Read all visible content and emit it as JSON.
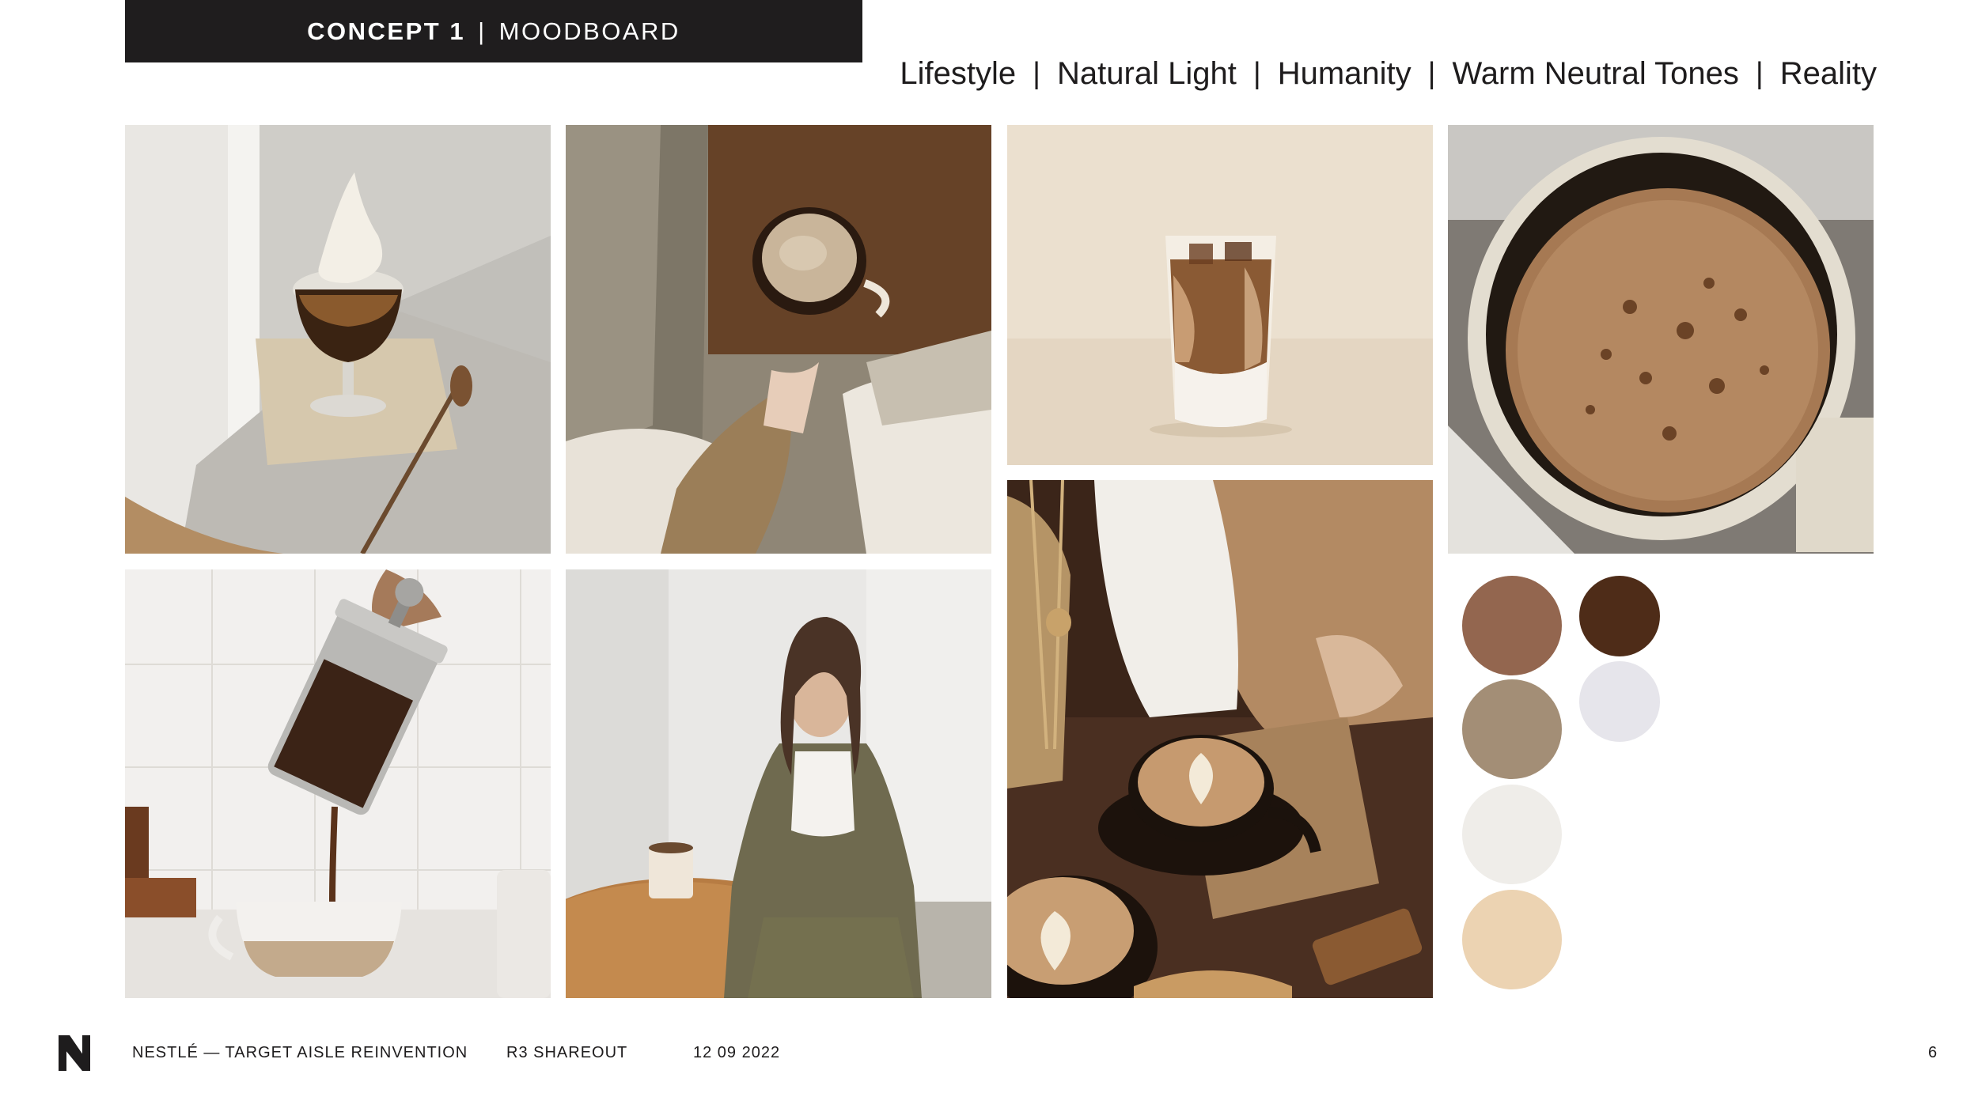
{
  "header": {
    "concept_label": "CONCEPT 1",
    "separator": "|",
    "board_label": "MOODBOARD"
  },
  "keywords": [
    "Lifestyle",
    "Natural Light",
    "Humanity",
    "Warm Neutral Tones",
    "Reality"
  ],
  "keyword_separator": "|",
  "images": [
    {
      "name": "affogato-dessert-image",
      "subject": "affogato in glass with spoon on napkin"
    },
    {
      "name": "coffee-mug-in-hand-image",
      "subject": "hand holding coffee mug on wooden table, knit sweater"
    },
    {
      "name": "iced-latte-image",
      "subject": "iced latte in glass on beige background"
    },
    {
      "name": "frothy-coffee-cup-image",
      "subject": "close-up frothy coffee in speckled mug"
    },
    {
      "name": "french-press-pour-image",
      "subject": "pouring coffee from french press into cup"
    },
    {
      "name": "woman-seated-image",
      "subject": "woman in olive outfit seated at wooden table"
    },
    {
      "name": "latte-art-table-image",
      "subject": "latte art cups on cafe table"
    }
  ],
  "palette": [
    {
      "name": "swatch-brown",
      "color": "#93664f"
    },
    {
      "name": "swatch-dark-brown",
      "color": "#4e2c18"
    },
    {
      "name": "swatch-taupe",
      "color": "#a38e76"
    },
    {
      "name": "swatch-lavender-white",
      "color": "#e6e5eb"
    },
    {
      "name": "swatch-off-white",
      "color": "#efede9"
    },
    {
      "name": "swatch-peach",
      "color": "#ecd3b2"
    }
  ],
  "footer": {
    "logo_letter": "N",
    "project": "NESTLÉ — TARGET AISLE REINVENTION",
    "phase": "R3 SHAREOUT",
    "date": "12 09 2022",
    "page_number": "6"
  }
}
